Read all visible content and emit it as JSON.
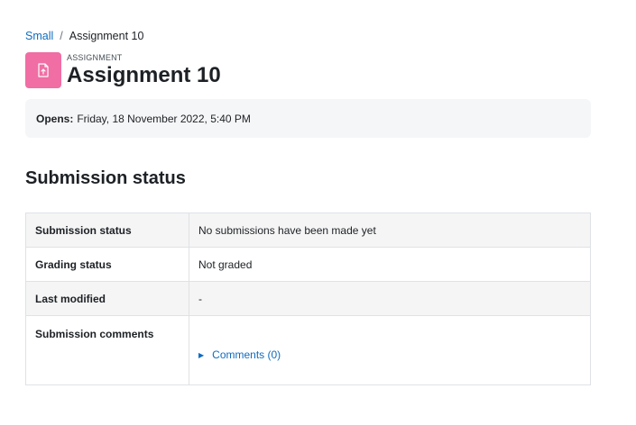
{
  "breadcrumb": {
    "items": [
      {
        "label": "Small"
      },
      {
        "label": "Assignment 10"
      }
    ],
    "separator": "/"
  },
  "header": {
    "module_type": "ASSIGNMENT",
    "title": "Assignment 10",
    "icon": "assignment-upload-icon",
    "icon_bg": "#f06ea4"
  },
  "dates": {
    "opens_label": "Opens:",
    "opens_value": "Friday, 18 November 2022, 5:40 PM"
  },
  "section": {
    "title": "Submission status"
  },
  "status_table": {
    "rows": [
      {
        "label": "Submission status",
        "value": "No submissions have been made yet"
      },
      {
        "label": "Grading status",
        "value": "Not graded"
      },
      {
        "label": "Last modified",
        "value": "-"
      },
      {
        "label": "Submission comments",
        "value": "Comments (0)"
      }
    ]
  },
  "colors": {
    "link": "#0f6cbf",
    "text": "#1d2125"
  }
}
